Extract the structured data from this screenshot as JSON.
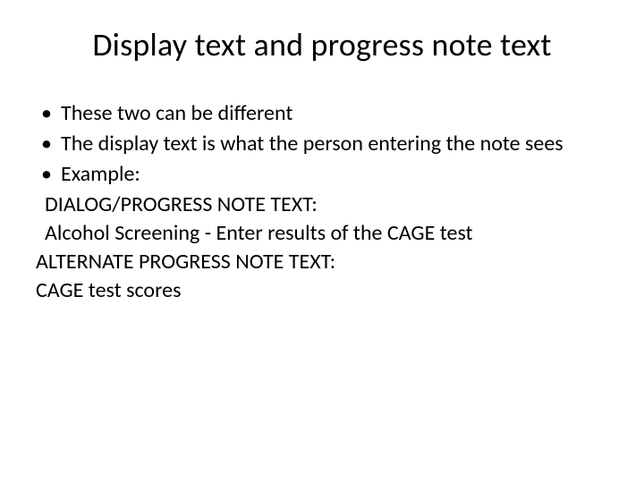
{
  "title": "Display text and progress note text",
  "bullets": [
    "These two can be different",
    "The display text is what the person entering the note sees",
    "Example:"
  ],
  "example_lines": {
    "l1": "DIALOG/PROGRESS NOTE TEXT:",
    "l2": "Alcohol Screening - Enter results of the CAGE test",
    "l3": "ALTERNATE PROGRESS NOTE TEXT:",
    "l4": "CAGE test scores"
  }
}
